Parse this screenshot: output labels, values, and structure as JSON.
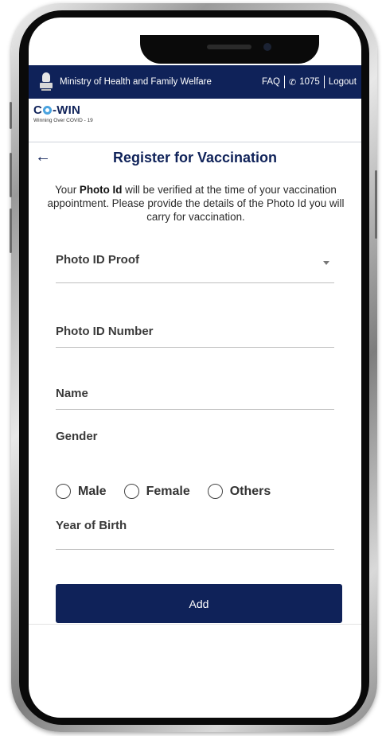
{
  "header": {
    "ministry": "Ministry of Health and Family Welfare",
    "faq": "FAQ",
    "helpline": "1075",
    "logout": "Logout"
  },
  "brand": {
    "logo_prefix": "C",
    "logo_suffix": "-WIN",
    "tagline": "Winning Over COVID - 19"
  },
  "page": {
    "title": "Register for Vaccination",
    "intro_before": "Your ",
    "intro_bold": "Photo Id",
    "intro_after": " will be verified at the time of your vaccination appointment. Please provide the details of the Photo Id you will carry for vaccination."
  },
  "form": {
    "photo_id_proof": "Photo ID Proof",
    "photo_id_number": "Photo ID Number",
    "name": "Name",
    "gender": "Gender",
    "gender_options": [
      "Male",
      "Female",
      "Others"
    ],
    "year_of_birth": "Year of Birth",
    "add_button": "Add"
  },
  "colors": {
    "primary": "#0f2259",
    "accent": "#4aa3df"
  },
  "icons": {
    "back": "back-arrow-icon",
    "phone": "phone-icon",
    "dropdown": "chevron-down-icon",
    "emblem": "emblem-icon"
  }
}
